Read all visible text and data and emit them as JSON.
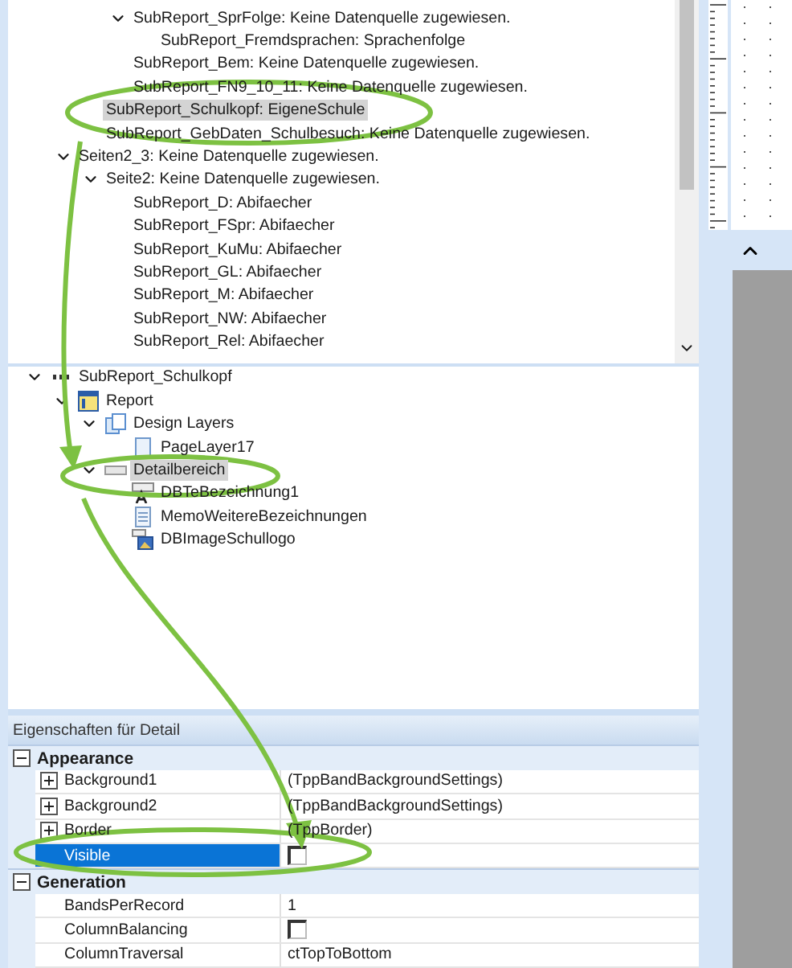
{
  "upper_tree": {
    "items": [
      {
        "children": [
          {
            "children": [
              {
                "label": "SubReport_SprFolge: Keine Datenquelle zugewiesen.",
                "selected": false,
                "expanded": true,
                "children": [
                  {
                    "label": "SubReport_Fremdsprachen: Sprachenfolge",
                    "selected": false
                  }
                ]
              },
              {
                "label": "SubReport_Bem: Keine Datenquelle zugewiesen.",
                "selected": false
              },
              {
                "label": "SubReport_FN9_10_11: Keine Datenquelle zugewiesen.",
                "selected": false
              }
            ]
          },
          {
            "label": "SubReport_Schulkopf: EigeneSchule",
            "selected": true
          },
          {
            "label": "SubReport_GebDaten_Schulbesuch: Keine Datenquelle zugewiesen.",
            "selected": false
          }
        ]
      },
      {
        "label": "Seiten2_3: Keine Datenquelle zugewiesen.",
        "selected": false,
        "expanded": true,
        "children": [
          {
            "label": "Seite2: Keine Datenquelle zugewiesen.",
            "selected": false,
            "expanded": true,
            "children": [
              {
                "label": "SubReport_D: Abifaecher",
                "selected": false
              },
              {
                "label": "SubReport_FSpr: Abifaecher",
                "selected": false
              },
              {
                "label": "SubReport_KuMu: Abifaecher",
                "selected": false
              },
              {
                "label": "SubReport_GL: Abifaecher",
                "selected": false
              },
              {
                "label": "SubReport_M: Abifaecher",
                "selected": false
              },
              {
                "label": "SubReport_NW: Abifaecher",
                "selected": false
              },
              {
                "label": "SubReport_Rel: Abifaecher",
                "selected": false
              }
            ]
          }
        ]
      }
    ]
  },
  "lower_tree": {
    "items": [
      {
        "label": "SubReport_Schulkopf",
        "kind": "subreport",
        "selected": false,
        "expanded": true,
        "children": [
          {
            "label": "Report",
            "kind": "report",
            "selected": false,
            "expanded": true,
            "children": [
              {
                "label": "Design Layers",
                "kind": "layers",
                "selected": false,
                "expanded": true,
                "children": [
                  {
                    "label": "PageLayer17",
                    "kind": "page",
                    "selected": false
                  }
                ]
              },
              {
                "label": "Detailbereich",
                "kind": "band",
                "selected": true,
                "expanded": true,
                "children": [
                  {
                    "label": "DBTeBezeichnung1",
                    "kind": "dbtext",
                    "selected": false
                  },
                  {
                    "label": "MemoWeitereBezeichnungen",
                    "kind": "memo",
                    "selected": false
                  },
                  {
                    "label": "DBImageSchullogo",
                    "kind": "image",
                    "selected": false
                  }
                ]
              }
            ]
          }
        ]
      }
    ]
  },
  "properties": {
    "title": "Eigenschaften für Detail",
    "categories": [
      {
        "name": "Appearance",
        "expanded": true,
        "rows": [
          {
            "name": "Background1",
            "kind": "text",
            "value": "(TppBandBackgroundSettings)",
            "expandable": true,
            "selected": false
          },
          {
            "name": "Background2",
            "kind": "text",
            "value": "(TppBandBackgroundSettings)",
            "expandable": true,
            "selected": false
          },
          {
            "name": "Border",
            "kind": "text",
            "value": "(TppBorder)",
            "expandable": true,
            "selected": false
          },
          {
            "name": "Visible",
            "kind": "checkbox",
            "checked": false,
            "expandable": false,
            "selected": true
          }
        ]
      },
      {
        "name": "Generation",
        "expanded": true,
        "rows": [
          {
            "name": "BandsPerRecord",
            "kind": "text",
            "value": "1",
            "expandable": false,
            "selected": false
          },
          {
            "name": "ColumnBalancing",
            "kind": "checkbox",
            "checked": false,
            "expandable": false,
            "selected": false
          },
          {
            "name": "ColumnTraversal",
            "kind": "text",
            "value": "ctTopToBottom",
            "expandable": false,
            "selected": false
          }
        ]
      }
    ]
  }
}
